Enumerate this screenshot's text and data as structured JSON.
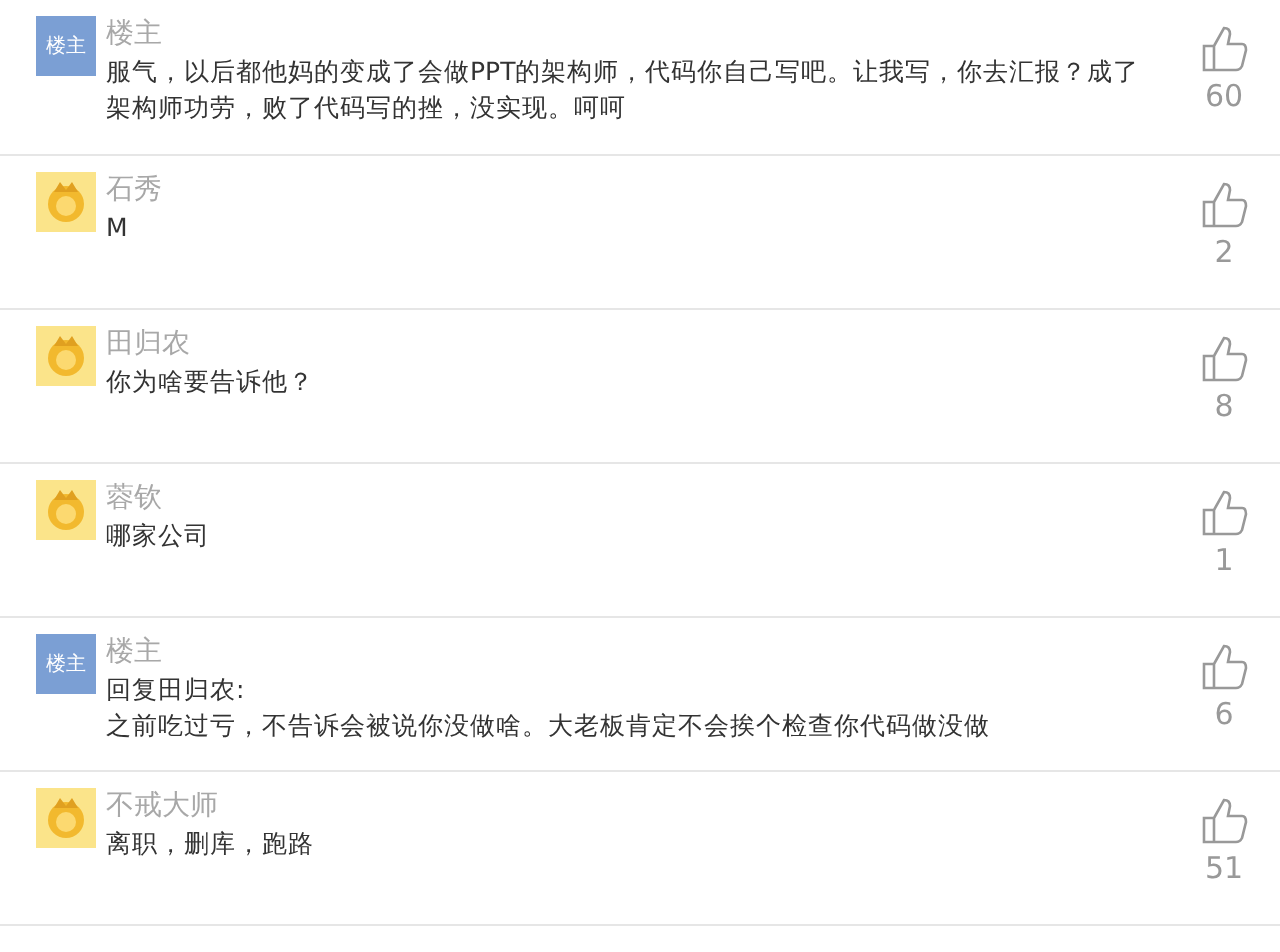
{
  "comments": [
    {
      "avatar": {
        "kind": "op",
        "label": "楼主"
      },
      "name": "楼主",
      "lines": [
        "服气，以后都他妈的变成了会做PPT的架构师，代码你自己写吧。让我写，你去汇报？成了架构师功劳，败了代码写的挫，没实现。呵呵"
      ],
      "likes": "60"
    },
    {
      "avatar": {
        "kind": "default"
      },
      "name": "石秀",
      "lines": [
        "M"
      ],
      "likes": "2"
    },
    {
      "avatar": {
        "kind": "default"
      },
      "name": "田归农",
      "lines": [
        "你为啥要告诉他？"
      ],
      "likes": "8"
    },
    {
      "avatar": {
        "kind": "default"
      },
      "name": "蓉钦",
      "lines": [
        "哪家公司"
      ],
      "likes": "1"
    },
    {
      "avatar": {
        "kind": "op",
        "label": "楼主"
      },
      "name": "楼主",
      "lines": [
        "回复田归农:",
        "之前吃过亏，不告诉会被说你没做啥。大老板肯定不会挨个检查你代码做没做"
      ],
      "likes": "6"
    },
    {
      "avatar": {
        "kind": "default"
      },
      "name": "不戒大师",
      "lines": [
        "离职，删库，跑路"
      ],
      "likes": "51"
    }
  ]
}
